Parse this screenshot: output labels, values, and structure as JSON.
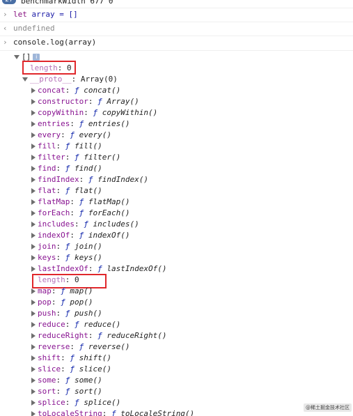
{
  "top_line": {
    "badge": "27",
    "text": "benchmarkWidth 677 0"
  },
  "entries": [
    {
      "arrow": "›",
      "keyword": "let",
      "text": " array = []"
    },
    {
      "arrow": "‹",
      "text": "undefined"
    },
    {
      "arrow": "›",
      "text": "console.log(array)"
    }
  ],
  "array_root": {
    "label": "[]",
    "info_icon": "i"
  },
  "length_top": {
    "key": "length",
    "value": "0"
  },
  "proto": {
    "key": "__proto__",
    "value": "Array(0)"
  },
  "methods": [
    {
      "key": "concat",
      "fn": "concat()"
    },
    {
      "key": "constructor",
      "fn": "Array()"
    },
    {
      "key": "copyWithin",
      "fn": "copyWithin()"
    },
    {
      "key": "entries",
      "fn": "entries()"
    },
    {
      "key": "every",
      "fn": "every()"
    },
    {
      "key": "fill",
      "fn": "fill()"
    },
    {
      "key": "filter",
      "fn": "filter()"
    },
    {
      "key": "find",
      "fn": "find()"
    },
    {
      "key": "findIndex",
      "fn": "findIndex()"
    },
    {
      "key": "flat",
      "fn": "flat()"
    },
    {
      "key": "flatMap",
      "fn": "flatMap()"
    },
    {
      "key": "forEach",
      "fn": "forEach()"
    },
    {
      "key": "includes",
      "fn": "includes()"
    },
    {
      "key": "indexOf",
      "fn": "indexOf()"
    },
    {
      "key": "join",
      "fn": "join()"
    },
    {
      "key": "keys",
      "fn": "keys()"
    },
    {
      "key": "lastIndexOf",
      "fn": "lastIndexOf()"
    }
  ],
  "length_proto": {
    "key": "length",
    "value": "0"
  },
  "methods2": [
    {
      "key": "map",
      "fn": "map()"
    },
    {
      "key": "pop",
      "fn": "pop()"
    },
    {
      "key": "push",
      "fn": "push()"
    },
    {
      "key": "reduce",
      "fn": "reduce()"
    },
    {
      "key": "reduceRight",
      "fn": "reduceRight()"
    },
    {
      "key": "reverse",
      "fn": "reverse()"
    },
    {
      "key": "shift",
      "fn": "shift()"
    },
    {
      "key": "slice",
      "fn": "slice()"
    },
    {
      "key": "some",
      "fn": "some()"
    },
    {
      "key": "sort",
      "fn": "sort()"
    },
    {
      "key": "splice",
      "fn": "splice()"
    },
    {
      "key": "toLocaleString",
      "fn": "toLocaleString()"
    }
  ],
  "fn_marker": "ƒ",
  "colors": {
    "highlight": "#e0272b",
    "key": "#881391",
    "keyword": "#881280"
  }
}
